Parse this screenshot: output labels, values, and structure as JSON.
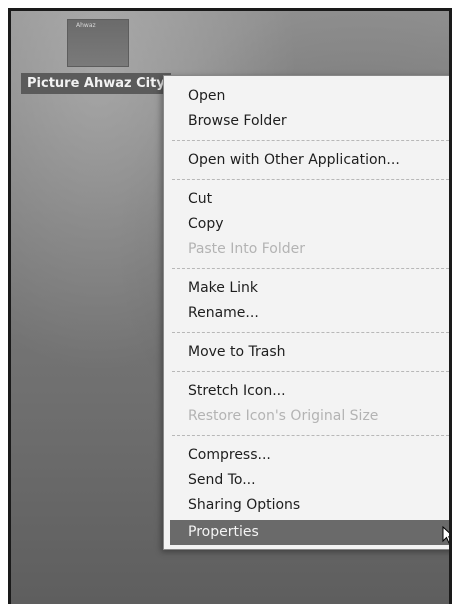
{
  "desktop": {
    "icon_label": "Picture Ahwaz City",
    "thumb_caption": "Ahwaz"
  },
  "menu": {
    "items": [
      {
        "label": "Open",
        "enabled": true
      },
      {
        "label": "Browse Folder",
        "enabled": true
      },
      {
        "label": "Open with Other Application...",
        "enabled": true
      },
      {
        "label": "Cut",
        "enabled": true
      },
      {
        "label": "Copy",
        "enabled": true
      },
      {
        "label": "Paste Into Folder",
        "enabled": false
      },
      {
        "label": "Make Link",
        "enabled": true
      },
      {
        "label": "Rename...",
        "enabled": true
      },
      {
        "label": "Move to Trash",
        "enabled": true
      },
      {
        "label": "Stretch Icon...",
        "enabled": true
      },
      {
        "label": "Restore Icon's Original Size",
        "enabled": false
      },
      {
        "label": "Compress...",
        "enabled": true
      },
      {
        "label": "Send To...",
        "enabled": true
      },
      {
        "label": "Sharing Options",
        "enabled": true
      },
      {
        "label": "Properties",
        "enabled": true,
        "highlighted": true
      }
    ]
  },
  "colors": {
    "menu_bg": "#f3f3f3",
    "highlight": "#6a6a6a",
    "disabled_text": "#b3b3b3"
  },
  "icons": {
    "cursor": "mouse-pointer-icon"
  }
}
